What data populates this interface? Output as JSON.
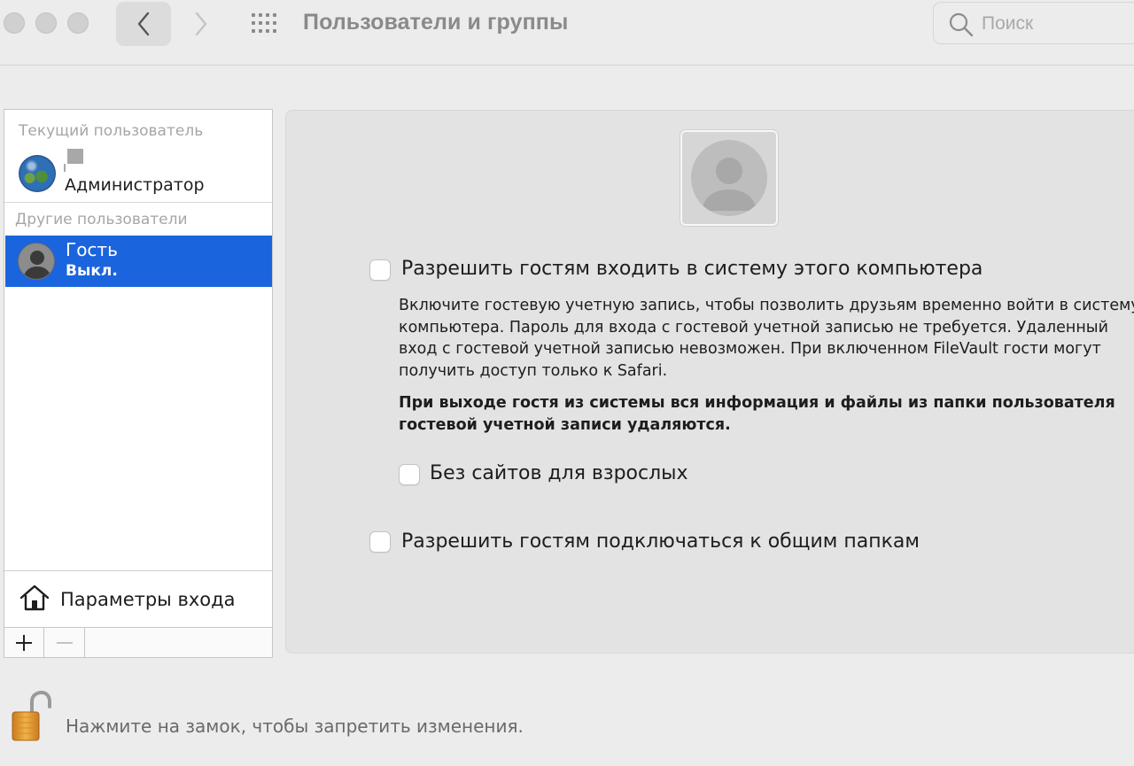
{
  "window": {
    "title": "Пользователи и группы"
  },
  "search": {
    "placeholder": "Поиск"
  },
  "sidebar": {
    "current_user_label": "Текущий пользователь",
    "current_user": {
      "role": "Администратор"
    },
    "other_users_label": "Другие пользователи",
    "other_users": [
      {
        "name": "Гость",
        "status": "Выкл.",
        "selected": true
      }
    ],
    "login_options_label": "Параметры входа"
  },
  "guest_panel": {
    "allow_login_label": "Разрешить гостям входить в систему этого компьютера",
    "allow_login_checked": false,
    "description": "Включите гостевую учетную запись, чтобы позволить друзьям временно войти в систему компьютера. Пароль для входа с гостевой учетной записью не требуется. Удаленный вход с гостевой учетной записью невозможен. При включенном FileVault гости могут получить доступ только к Safari.",
    "warning": "При выходе гостя из системы вся информация и файлы из папки пользователя гостевой учетной записи удаляются.",
    "no_adult_sites_label": "Без сайтов для взрослых",
    "no_adult_sites_checked": false,
    "shared_folders_label": "Разрешить гостям подключаться к общим папкам",
    "shared_folders_checked": false
  },
  "lock": {
    "text": "Нажмите на замок, чтобы запретить изменения."
  },
  "colors": {
    "selection": "#1a64de",
    "window_bg": "#ececec",
    "panel_bg": "#e3e3e3"
  }
}
